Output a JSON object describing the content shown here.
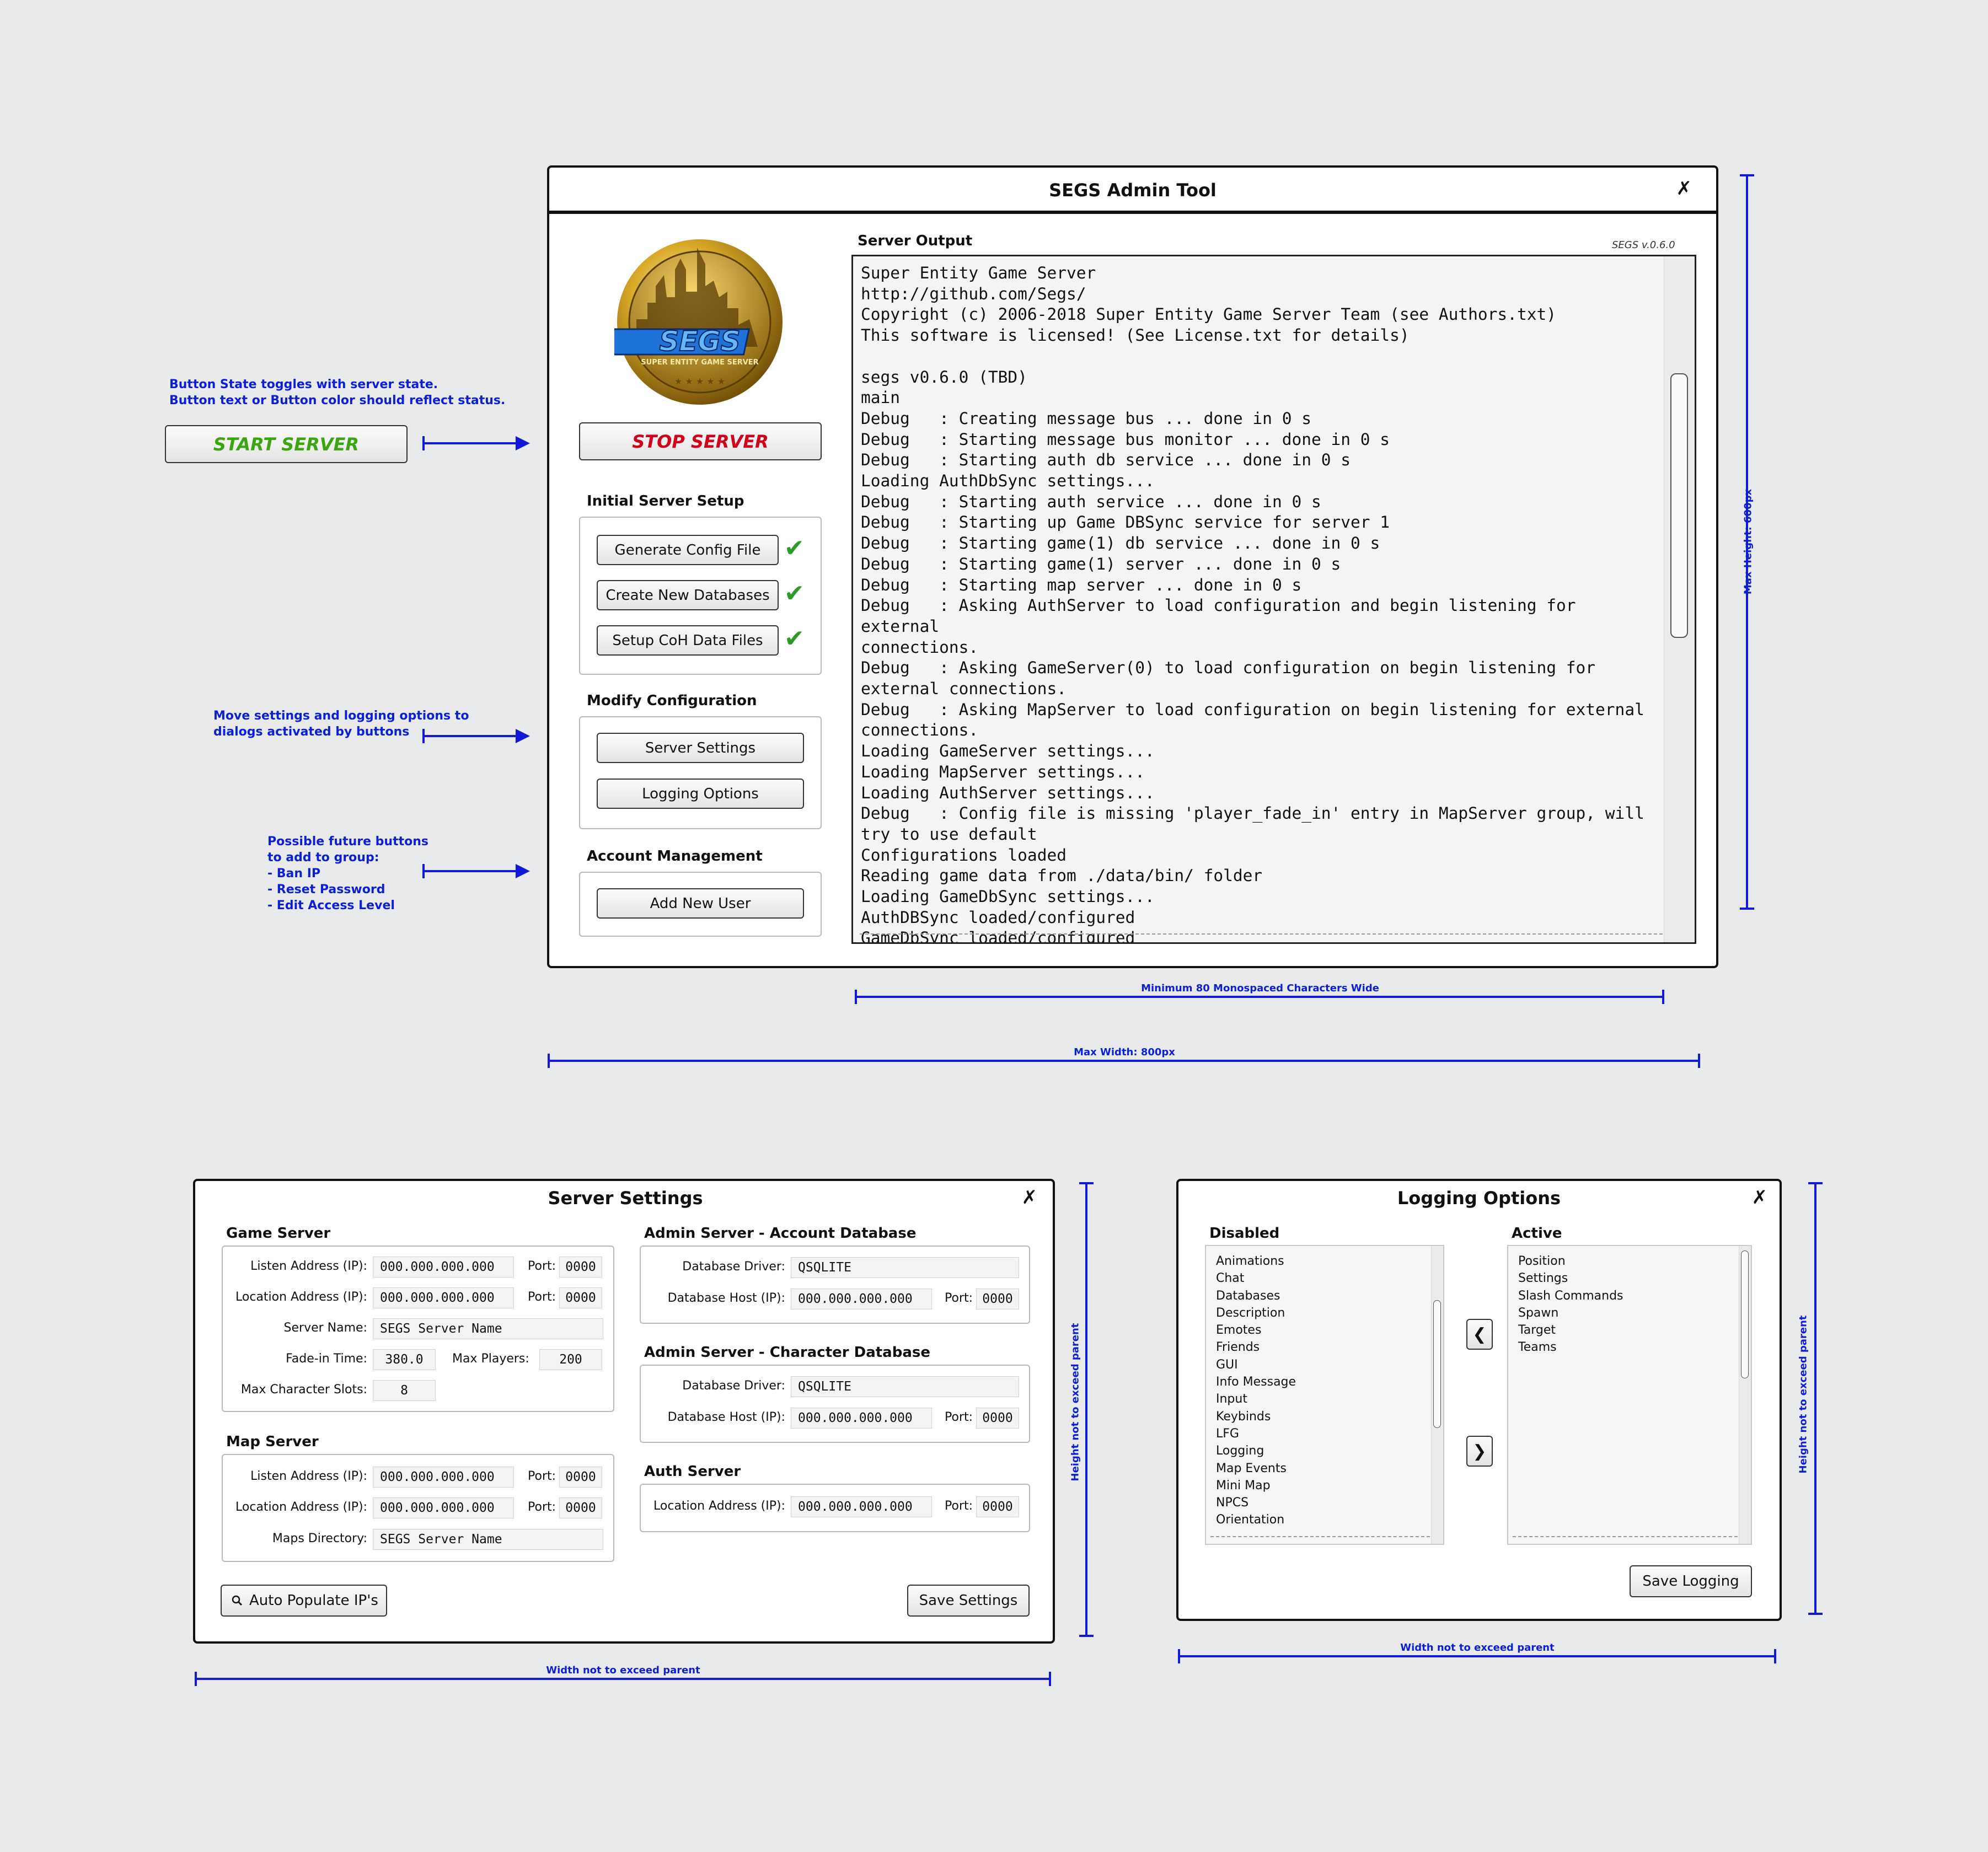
{
  "main_window": {
    "title": "SEGS Admin Tool",
    "close_icon": "x",
    "logo": {
      "text": "SEGS",
      "subtext": "SUPER ENTITY GAME SERVER"
    },
    "stop_button": "STOP SERVER",
    "stop_color": "#d0021b",
    "server_output_label": "Server Output",
    "version": "SEGS v.0.6.0",
    "initial_setup": {
      "label": "Initial Server Setup",
      "buttons": [
        "Generate Config File",
        "Create New Databases",
        "Setup CoH Data Files"
      ],
      "check_icon": "✔"
    },
    "modify_config": {
      "label": "Modify Configuration",
      "buttons": [
        "Server Settings",
        "Logging Options"
      ]
    },
    "account_mgmt": {
      "label": "Account Management",
      "buttons": [
        "Add New User"
      ]
    },
    "console_lines": [
      "Super Entity Game Server",
      "http://github.com/Segs/",
      "Copyright (c) 2006-2018 Super Entity Game Server Team (see Authors.txt)",
      "This software is licensed! (See License.txt for details)",
      "",
      "segs v0.6.0 (TBD)",
      "main",
      "Debug   : Creating message bus ... done in 0 s",
      "Debug   : Starting message bus monitor ... done in 0 s",
      "Debug   : Starting auth db service ... done in 0 s",
      "Loading AuthDbSync settings...",
      "Debug   : Starting auth service ... done in 0 s",
      "Debug   : Starting up Game DBSync service for server 1",
      "Debug   : Starting game(1) db service ... done in 0 s",
      "Debug   : Starting game(1) server ... done in 0 s",
      "Debug   : Starting map server ... done in 0 s",
      "Debug   : Asking AuthServer to load configuration and begin listening for external",
      "connections.",
      "Debug   : Asking GameServer(0) to load configuration on begin listening for",
      "external connections.",
      "Debug   : Asking MapServer to load configuration on begin listening for external",
      "connections.",
      "Loading GameServer settings...",
      "Loading MapServer settings...",
      "Loading AuthServer settings...",
      "Debug   : Config file is missing 'player_fade_in' entry in MapServer group, will",
      "try to use default",
      "Configurations loaded",
      "Reading game data from ./data/bin/ folder",
      "Loading GameDbSync settings...",
      "AuthDBSync loaded/configured",
      "GameDbSync loaded/configured"
    ]
  },
  "annotations": {
    "button_state_note": "Button State toggles with server state.\nButton text or Button color should reflect status.",
    "start_button": "START SERVER",
    "start_color": "#3aa612",
    "move_settings_note": "Move settings and logging options to\ndialogs activated by buttons",
    "future_buttons_note": "Possible future buttons\nto add to group:\n- Ban IP\n- Reset Password\n- Edit Access Level",
    "max_height": "Max Height: 600px",
    "min_width": "Minimum 80 Monospaced Characters Wide",
    "max_width": "Max Width: 800px",
    "settings_height": "Height not to exceed parent",
    "settings_width": "Width not to exceed parent",
    "logging_height": "Height not to exceed parent",
    "logging_width": "Width not to exceed parent"
  },
  "server_settings": {
    "title": "Server Settings",
    "close_icon": "x",
    "game_server": {
      "label": "Game Server",
      "listen_label": "Listen Address (IP):",
      "listen_value": "000.000.000.000",
      "location_label": "Location Address (IP):",
      "location_value": "000.000.000.000",
      "port_label": "Port:",
      "listen_port": "0000",
      "location_port": "0000",
      "name_label": "Server Name:",
      "name_value": "SEGS Server Name",
      "fade_label": "Fade-in Time:",
      "fade_value": "380.0",
      "players_label": "Max Players:",
      "players_value": "200",
      "slots_label": "Max Character Slots:",
      "slots_value": "8"
    },
    "map_server": {
      "label": "Map Server",
      "listen_label": "Listen Address (IP):",
      "listen_value": "000.000.000.000",
      "location_label": "Location Address (IP):",
      "location_value": "000.000.000.000",
      "port_label": "Port:",
      "listen_port": "0000",
      "location_port": "0000",
      "maps_label": "Maps Directory:",
      "maps_value": "SEGS Server Name"
    },
    "account_db": {
      "label": "Admin Server - Account Database",
      "driver_label": "Database Driver:",
      "driver_value": "QSQLITE",
      "host_label": "Database Host (IP):",
      "host_value": "000.000.000.000",
      "port_label": "Port:",
      "port_value": "0000"
    },
    "character_db": {
      "label": "Admin Server - Character Database",
      "driver_label": "Database Driver:",
      "driver_value": "QSQLITE",
      "host_label": "Database Host (IP):",
      "host_value": "000.000.000.000",
      "port_label": "Port:",
      "port_value": "0000"
    },
    "auth_server": {
      "label": "Auth Server",
      "location_label": "Location Address (IP):",
      "location_value": "000.000.000.000",
      "port_label": "Port:",
      "port_value": "0000"
    },
    "auto_populate": "Auto Populate IP's",
    "search_icon": "magnifier",
    "save": "Save Settings"
  },
  "logging_options": {
    "title": "Logging Options",
    "close_icon": "x",
    "disabled_label": "Disabled",
    "active_label": "Active",
    "disabled_items": [
      "Animations",
      "Chat",
      "Databases",
      "Description",
      "Emotes",
      "Friends",
      "GUI",
      "Info Message",
      "Input",
      "Keybinds",
      "LFG",
      "Logging",
      "Map Events",
      "Mini Map",
      "NPCS",
      "Orientation"
    ],
    "active_items": [
      "Position",
      "Settings",
      "Slash Commands",
      "Spawn",
      "Target",
      "Teams"
    ],
    "move_left_icon": "❮",
    "move_right_icon": "❯",
    "save": "Save Logging"
  }
}
